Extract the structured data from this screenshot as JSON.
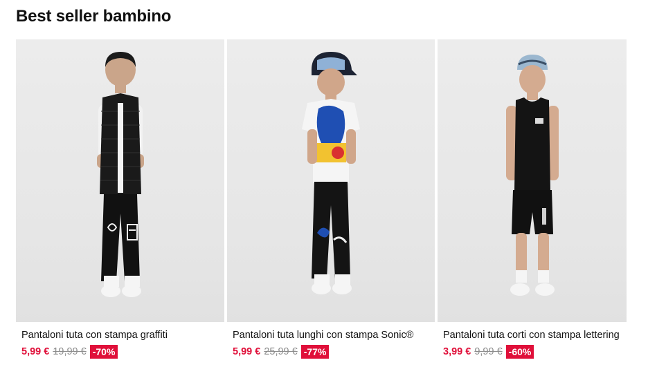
{
  "section": {
    "title": "Best seller bambino"
  },
  "products": [
    {
      "name": "Pantaloni tuta con stampa graffiti",
      "price": "5,99 €",
      "old_price": "19,99 €",
      "discount": "-70%"
    },
    {
      "name": "Pantaloni tuta lunghi con stampa Sonic®",
      "price": "5,99 €",
      "old_price": "25,99 €",
      "discount": "-77%"
    },
    {
      "name": "Pantaloni tuta corti con stampa lettering",
      "price": "3,99 €",
      "old_price": "9,99 €",
      "discount": "-60%"
    }
  ],
  "colors": {
    "sale_red": "#e0103a",
    "old_price_gray": "#8a8a8a",
    "image_background": "#e8e8e8"
  }
}
